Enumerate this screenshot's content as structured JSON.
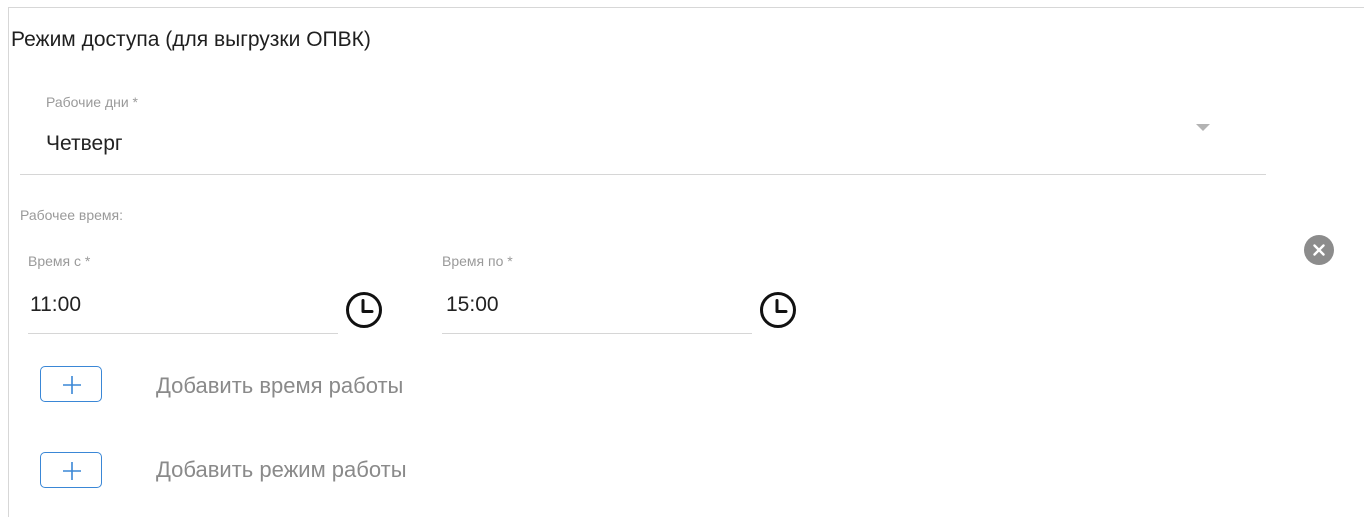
{
  "section": {
    "title": "Режим доступа (для выгрузки ОПВК)"
  },
  "work_days": {
    "label": "Рабочие дни *",
    "value": "Четверг",
    "arrow_icon": "triangle-down-icon"
  },
  "work_time": {
    "label": "Рабочее время:",
    "time_from": {
      "label": "Время с *",
      "value": "11:00",
      "icon": "clock-icon"
    },
    "time_to": {
      "label": "Время по *",
      "value": "15:00",
      "icon": "clock-icon"
    },
    "remove_icon": "close-circle-icon"
  },
  "actions": {
    "add_time_label": "Добавить время работы",
    "add_mode_label": "Добавить режим работы",
    "add_icon": "plus-icon"
  },
  "colors": {
    "accent": "#3a87d6",
    "muted_text": "#8a8a8a",
    "label_text": "#9a9a9a",
    "underline": "#d6d6d6",
    "remove_button": "#8c8c8c"
  }
}
